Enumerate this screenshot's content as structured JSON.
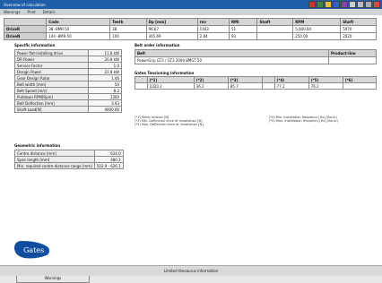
{
  "window": {
    "title": "Overview of calculation"
  },
  "menu": {
    "items": [
      "Warnings",
      "Print",
      "Details"
    ]
  },
  "drive_table": {
    "headers": [
      "",
      "Code",
      "Teeth",
      "Dp [mm]",
      "rev",
      "RMI",
      "Shaft",
      "RPM",
      "Shaft"
    ],
    "rows": [
      [
        "DriveR",
        "38 -8MR-50",
        "38",
        "96.67",
        "1163",
        "51",
        "",
        "5,000.00",
        "5070"
      ],
      [
        "DriveN",
        "144 -8MR-50",
        "100",
        "365.69",
        "2.84",
        "92",
        "",
        "250.00",
        "2020"
      ]
    ]
  },
  "specs": {
    "title": "Specific information",
    "rows": [
      [
        "Power flat-installing drive",
        "11.8 kW"
      ],
      [
        "DR Power",
        "20.8 kW"
      ],
      [
        "Service Factor",
        "1.0"
      ],
      [
        "Design Power",
        "22.8 kW"
      ],
      [
        "Gear Design Ratio",
        "1.46"
      ],
      [
        "Belt width [mm]",
        "50"
      ],
      [
        "Belt Speed [m/s]",
        "8.2"
      ],
      [
        "Pulldown RPM[Rpm]",
        "1300"
      ],
      [
        "Belt Deflection [mm]",
        "3.93"
      ],
      [
        "Shaft Load[N]",
        "4000.06"
      ]
    ]
  },
  "belt_order": {
    "title": "Belt order information",
    "headers": [
      "Belt",
      "Product-line"
    ],
    "rows": [
      [
        "PowerGrip GT3 / GT3 2000 8MGT 50",
        ""
      ]
    ]
  },
  "belt_tension": {
    "title": "Gates Tensioning information",
    "headers": [
      "",
      "(*1)",
      "(*2)",
      "(*3)",
      "",
      "(*4)",
      "(*5)",
      "(*6)"
    ],
    "rows": [
      [
        "",
        "2320.2",
        "36.2",
        "85.7",
        "",
        "77.2",
        "76.2",
        ""
      ]
    ],
    "notes_left": [
      "(*1) Static tension [N]",
      "(*2) Min. Deflection force at installation [N]",
      "(*3) Max. Deflection force at installation [N]"
    ],
    "notes_right": [
      "(*4) Min. installation frequency [Hz] (Sonic)",
      "(*5) Max. installation frequency [Hz] (Sonic)"
    ]
  },
  "geometry": {
    "title": "Geometric information",
    "rows": [
      [
        "Centre distance [mm]",
        "624.0"
      ],
      [
        "Span length [mm]",
        "480.2"
      ],
      [
        "Min. required centre distance range [mm]",
        "502.9 - 626.1"
      ]
    ]
  },
  "logo": {
    "text": "Gates"
  },
  "warning_button": {
    "label": "Warnings"
  },
  "statusbar": {
    "text": "Limited thesaurus information"
  }
}
